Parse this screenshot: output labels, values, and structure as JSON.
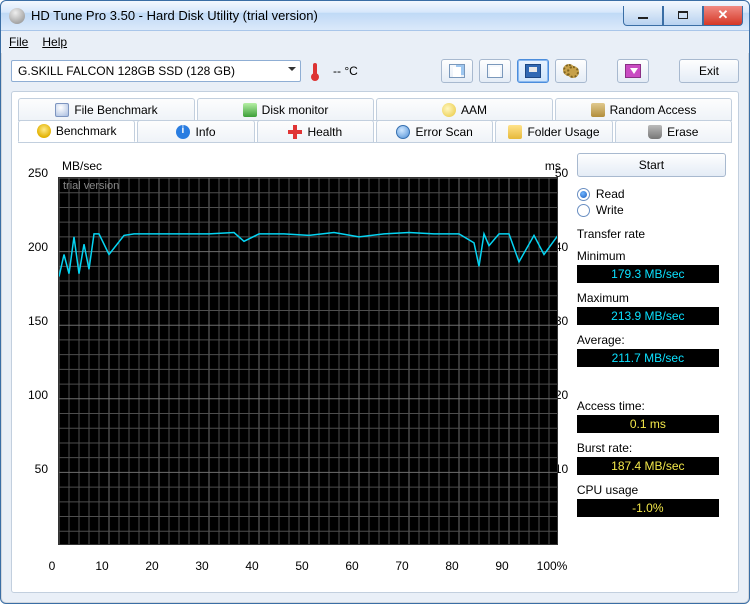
{
  "window": {
    "title": "HD Tune Pro 3.50 - Hard Disk Utility (trial version)"
  },
  "menubar": {
    "file": "File",
    "help": "Help"
  },
  "toolbar": {
    "drive": "G.SKILL FALCON 128GB SSD (128 GB)",
    "temp": "-- °C",
    "exit": "Exit"
  },
  "tabs_top": {
    "file_benchmark": "File Benchmark",
    "disk_monitor": "Disk monitor",
    "aam": "AAM",
    "random_access": "Random Access"
  },
  "tabs": {
    "benchmark": "Benchmark",
    "info": "Info",
    "health": "Health",
    "error_scan": "Error Scan",
    "folder_usage": "Folder Usage",
    "erase": "Erase"
  },
  "chart": {
    "y_left_label": "MB/sec",
    "y_right_label": "ms",
    "watermark": "trial version"
  },
  "right": {
    "start": "Start",
    "read": "Read",
    "write": "Write",
    "transfer_rate": "Transfer rate",
    "minimum": "Minimum",
    "minimum_val": "179.3 MB/sec",
    "maximum": "Maximum",
    "maximum_val": "213.9 MB/sec",
    "average": "Average:",
    "average_val": "211.7 MB/sec",
    "access_time": "Access time:",
    "access_time_val": "0.1 ms",
    "burst_rate": "Burst rate:",
    "burst_rate_val": "187.4 MB/sec",
    "cpu_usage": "CPU usage",
    "cpu_usage_val": "-1.0%"
  },
  "chart_data": {
    "type": "line",
    "xlabel": "%",
    "x_ticks": [
      0,
      10,
      20,
      30,
      40,
      50,
      60,
      70,
      80,
      90,
      100
    ],
    "x_tick_labels": [
      "0",
      "10",
      "20",
      "30",
      "40",
      "50",
      "60",
      "70",
      "80",
      "90",
      "100%"
    ],
    "y_left": {
      "label": "MB/sec",
      "range": [
        0,
        250
      ],
      "ticks": [
        50,
        100,
        150,
        200,
        250
      ]
    },
    "y_right": {
      "label": "ms",
      "range": [
        0,
        50
      ],
      "ticks": [
        10,
        20,
        30,
        40,
        50
      ]
    },
    "series": [
      {
        "name": "Transfer rate",
        "axis": "left",
        "unit": "MB/sec",
        "color": "#06d4f2",
        "x": [
          0,
          1,
          2,
          3,
          4,
          5,
          6,
          7,
          8,
          10,
          13,
          15,
          20,
          25,
          30,
          35,
          37,
          40,
          45,
          50,
          55,
          60,
          65,
          70,
          75,
          80,
          83,
          84,
          85,
          86,
          88,
          90,
          92,
          95,
          97,
          100
        ],
        "y": [
          183,
          198,
          185,
          210,
          185,
          205,
          188,
          212,
          212,
          198,
          211,
          212,
          212,
          212,
          212,
          213,
          207,
          212,
          212,
          211,
          213,
          210,
          212,
          213,
          212,
          212,
          206,
          190,
          212,
          204,
          212,
          212,
          193,
          211,
          198,
          212
        ]
      },
      {
        "name": "Access time",
        "axis": "right",
        "unit": "ms",
        "color": "#d6d045",
        "x": [
          0,
          10,
          20,
          30,
          40,
          50,
          60,
          70,
          80,
          90,
          100
        ],
        "y": [
          0.1,
          0.1,
          0.1,
          0.1,
          0.1,
          0.1,
          0.1,
          0.1,
          0.1,
          0.1,
          0.1
        ]
      }
    ]
  }
}
